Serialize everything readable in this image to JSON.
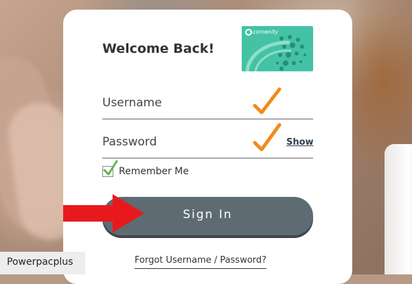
{
  "login": {
    "title": "Welcome Back!",
    "username_label": "Username",
    "password_label": "Password",
    "show_label": "Show",
    "remember_label": "Remember Me",
    "remember_checked": true,
    "sign_in_label": "Sign In",
    "forgot_label": "Forgot Username / Password?"
  },
  "brand_card": {
    "logo_text": "comenity",
    "color": "#44c2a6"
  },
  "annotations": {
    "check_color": "#f28a1c",
    "arrow_color": "#e8191c"
  },
  "watermark": {
    "text": "Powerpacplus"
  },
  "icons": [
    "checkmark-icon",
    "red-arrow-icon",
    "comenity-logo-icon"
  ]
}
